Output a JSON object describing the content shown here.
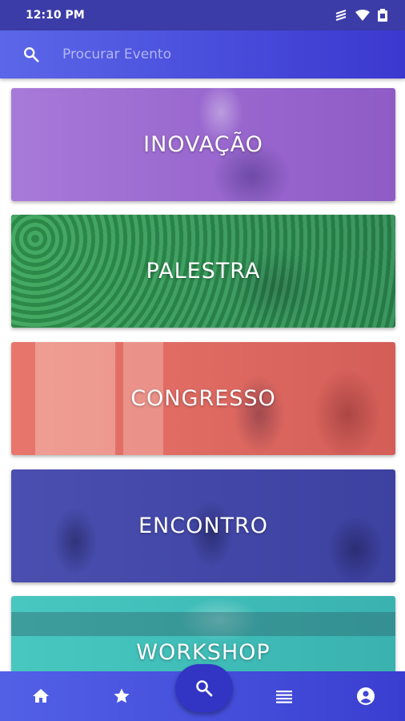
{
  "status_bar": {
    "time": "12:10 PM"
  },
  "search": {
    "placeholder": "Procurar Evento"
  },
  "categories": [
    {
      "label": "INOVAÇÃO"
    },
    {
      "label": "PALESTRA"
    },
    {
      "label": "CONGRESSO"
    },
    {
      "label": "ENCONTRO"
    },
    {
      "label": "WORKSHOP"
    }
  ],
  "bottom_nav": {
    "items": [
      "home-icon",
      "star-icon",
      "search-icon",
      "list-icon",
      "account-icon"
    ]
  },
  "colors": {
    "status_bar": "#3c3ca8",
    "accent": "#4a4fdc",
    "inovacao": "#9b6ad0",
    "palestra": "#33965a",
    "congresso": "#de6a62",
    "encontro": "#4348a8",
    "workshop": "#40bdb8"
  }
}
